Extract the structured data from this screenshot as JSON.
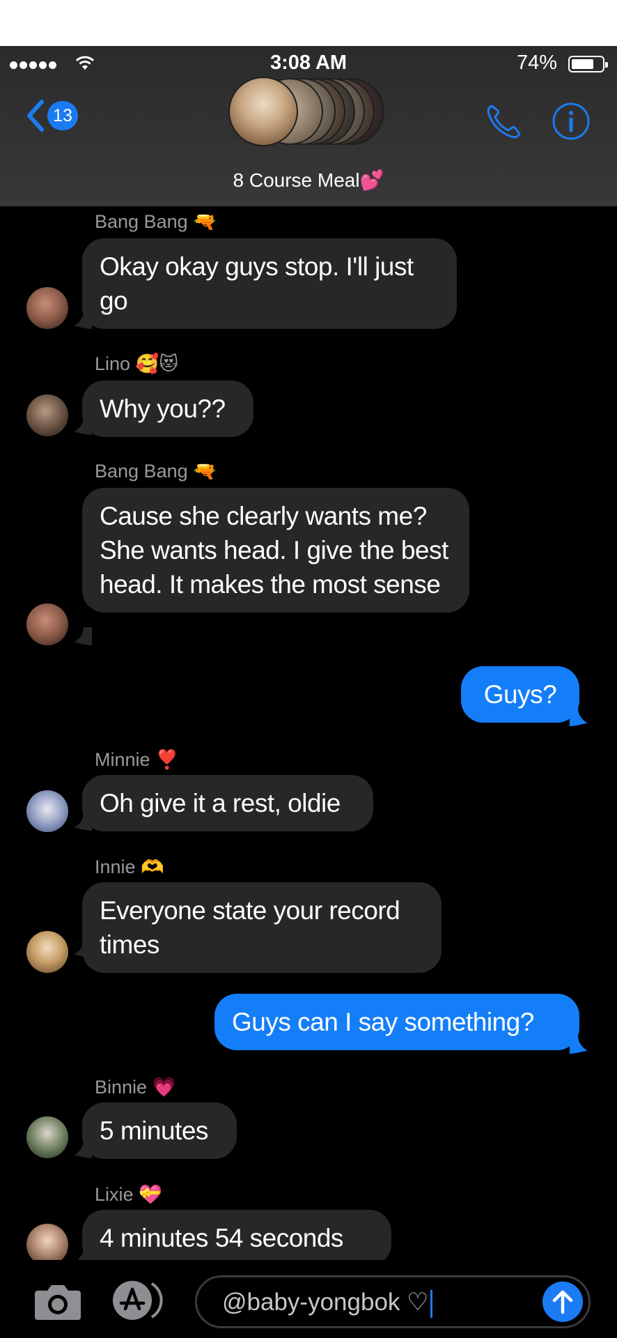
{
  "status_bar": {
    "time": "3:08 AM",
    "battery_percent": "74%",
    "battery_level": 0.74
  },
  "header": {
    "back_count": "13",
    "group_name": "8 Course Meal💕"
  },
  "messages": [
    {
      "sender": "Bang Bang 🔫",
      "text": "Okay okay guys stop. I'll just go",
      "direction": "incoming"
    },
    {
      "sender": "Lino 🥰😻",
      "text": "Why you??",
      "direction": "incoming"
    },
    {
      "sender": "Bang Bang 🔫",
      "text": "Cause she clearly wants me? She wants head. I give the best head. It makes the most sense",
      "direction": "incoming"
    },
    {
      "text": "Guys?",
      "direction": "outgoing"
    },
    {
      "sender": "Minnie ❣️",
      "text": "Oh give it a rest, oldie",
      "direction": "incoming"
    },
    {
      "sender": "Innie 🫶",
      "text": "Everyone state your record times",
      "direction": "incoming"
    },
    {
      "text": "Guys can I say something?",
      "direction": "outgoing"
    },
    {
      "sender": "Binnie 💗",
      "text": "5 minutes",
      "direction": "incoming"
    },
    {
      "sender": "Lixie 💝",
      "text": "4 minutes 54 seconds",
      "direction": "incoming"
    }
  ],
  "input": {
    "value": "@baby-yongbok ♡"
  },
  "colors": {
    "accent": "#1b7bf3",
    "incoming_bubble": "#27272a",
    "outgoing_bubble": "#147ef9",
    "header_bg": "#333334"
  },
  "icons": [
    "back-chevron-icon",
    "phone-icon",
    "info-icon",
    "camera-icon",
    "app-store-icon",
    "send-arrow-icon"
  ]
}
